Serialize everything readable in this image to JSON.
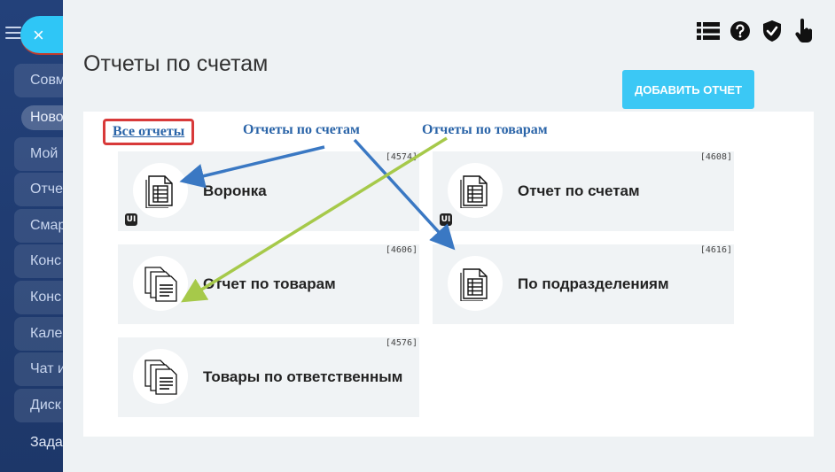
{
  "background": {
    "menu_items": [
      "Совм",
      "Ново",
      "Мой",
      "Отче",
      "Смар",
      "Конс",
      "Конс",
      "Кале",
      "Чат и",
      "Диск",
      "Зада"
    ]
  },
  "close_button": {
    "label": "×"
  },
  "header": {
    "title": "Отчеты по счетам",
    "icons": [
      "list-icon",
      "help-icon",
      "shield-check-icon",
      "pointer-hand-icon"
    ],
    "add_button": "ДОБАВИТЬ ОТЧЕТ"
  },
  "tabs": [
    {
      "label": "Все отчеты",
      "active": true
    },
    {
      "label": "Отчеты по счетам",
      "active": false
    },
    {
      "label": "Отчеты по товарам",
      "active": false
    }
  ],
  "reports": [
    {
      "id": "[4574]",
      "title": "Воронка",
      "badge": "UI",
      "icon": "report-document-icon"
    },
    {
      "id": "[4608]",
      "title": "Отчет по счетам",
      "badge": "UI",
      "icon": "report-document-icon"
    },
    {
      "id": "[4606]",
      "title": "Отчет по товарам",
      "icon": "products-report-icon"
    },
    {
      "id": "[4616]",
      "title": "По подразделениям",
      "icon": "report-document-icon"
    },
    {
      "id": "[4576]",
      "title": "Товары по ответственным",
      "icon": "products-report-icon"
    }
  ],
  "colors": {
    "accent": "#3bc8f5",
    "tab_link": "#2a64a8",
    "highlight_border": "#d83a3a",
    "arrow_blue": "#3a78c3",
    "arrow_green": "#a6c94a"
  }
}
